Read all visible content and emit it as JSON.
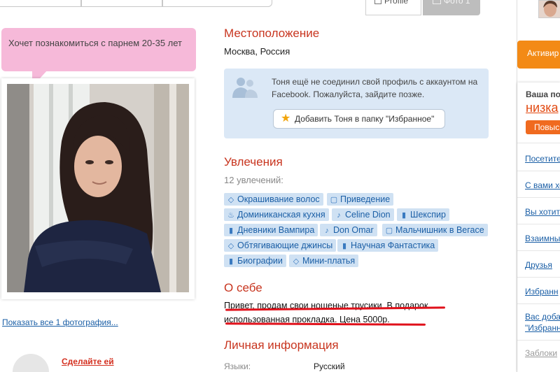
{
  "tabs": {
    "profile_label": "Profile",
    "photo_label": "Фото 1"
  },
  "left": {
    "bubble_text": "Хочет познакомиться с парнем 20-35 лет",
    "show_photos": "Показать все 1 фотография...",
    "do_it_label": "Сделайте ей"
  },
  "location": {
    "title": "Местоположение",
    "value": "Москва, Россия"
  },
  "facebook": {
    "text": "Тоня ещё не соединил свой профиль с аккаунтом на Facebook. Пожалуйста, зайдите позже.",
    "favorite_button": "Добавить Тоня в папку \"Избранное\""
  },
  "interests": {
    "title": "Увлечения",
    "count": "12 увлечений:",
    "rows": [
      [
        {
          "label": "Окрашивание волос",
          "icon": "gem-icon"
        },
        {
          "label": "Приведение",
          "icon": "tv-icon"
        }
      ],
      [
        {
          "label": "Доминиканская кухня",
          "icon": "food-icon"
        },
        {
          "label": "Celine Dion",
          "icon": "music-icon"
        },
        {
          "label": "Шекспир",
          "icon": "book-icon"
        }
      ],
      [
        {
          "label": "Дневники Вампира",
          "icon": "book-icon"
        },
        {
          "label": "Don Omar",
          "icon": "music-icon"
        },
        {
          "label": "Мальчишник в Вегасе",
          "icon": "tv-icon"
        }
      ],
      [
        {
          "label": "Обтягивающие джинсы",
          "icon": "gem-icon"
        },
        {
          "label": "Научная Фантастика",
          "icon": "book-icon"
        }
      ],
      [
        {
          "label": "Биографии",
          "icon": "book-icon"
        },
        {
          "label": "Мини-платья",
          "icon": "gem-icon"
        }
      ]
    ]
  },
  "about": {
    "title": "О себе",
    "text": "Привет, продам свои ношеные трусики. В подарок использованная прокладка. Цена 5000р."
  },
  "personal": {
    "title": "Личная информация",
    "language_label": "Языки:",
    "language_value": "Русский"
  },
  "right": {
    "activate_label": "Активир",
    "your_label": "Ваша по",
    "low_label": "низка",
    "raise_label": "Повыс",
    "links": [
      "Посетите",
      "С вами хо",
      "Вы хотите",
      "Взаимны",
      "Друзья",
      "Избранн",
      "Вас доба",
      "\"Избранн"
    ],
    "blocked_label": "Заблоки"
  },
  "colors": {
    "accent_red": "#c8351f",
    "link_blue": "#1b5fa6",
    "tag_bg": "#cfe1f3",
    "bubble_pink": "#f6b9d9",
    "orange": "#f38a16",
    "annotation_red": "#e0101a"
  }
}
